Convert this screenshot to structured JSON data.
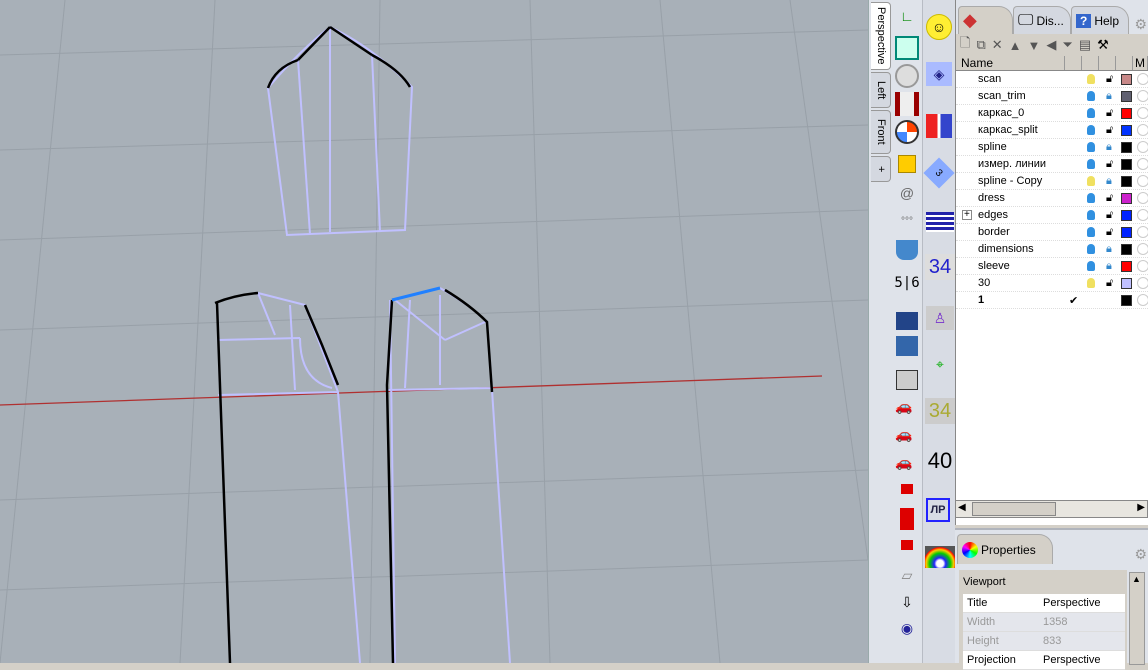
{
  "viewport_tabs": [
    {
      "label": "Perspective",
      "active": true
    },
    {
      "label": "Left"
    },
    {
      "label": "Front"
    },
    {
      "label": "+"
    }
  ],
  "panel_tabs": [
    {
      "label": "",
      "icon": "layers-icon"
    },
    {
      "label": "Dis...",
      "icon": "display-icon"
    },
    {
      "label": "Help",
      "icon": "help-icon"
    }
  ],
  "layers": {
    "header": {
      "name": "Name",
      "m": "M"
    },
    "rows": [
      {
        "name": "scan",
        "bulb": "#f0e060",
        "locked": false,
        "color": "#c88888"
      },
      {
        "name": "scan_trim",
        "bulb": "#3090e0",
        "locked": true,
        "color": "#606070"
      },
      {
        "name": "каркас_0",
        "bulb": "#3090e0",
        "locked": false,
        "color": "#ff0000"
      },
      {
        "name": "каркас_split",
        "bulb": "#3090e0",
        "locked": false,
        "color": "#0033ff"
      },
      {
        "name": "spline",
        "bulb": "#3090e0",
        "locked": true,
        "color": "#000000"
      },
      {
        "name": "измер. линии",
        "bulb": "#3090e0",
        "locked": false,
        "color": "#000000"
      },
      {
        "name": "spline - Copy",
        "bulb": "#f0e060",
        "locked": true,
        "color": "#000000"
      },
      {
        "name": "dress",
        "bulb": "#3090e0",
        "locked": false,
        "color": "#cc22cc"
      },
      {
        "name": "edges",
        "bulb": "#3090e0",
        "locked": false,
        "color": "#0022ff",
        "expand": "+"
      },
      {
        "name": "border",
        "bulb": "#3090e0",
        "locked": false,
        "color": "#0022ff"
      },
      {
        "name": "dimensions",
        "bulb": "#3090e0",
        "locked": true,
        "color": "#000000"
      },
      {
        "name": "sleeve",
        "bulb": "#3090e0",
        "locked": true,
        "color": "#ff0000"
      },
      {
        "name": "30",
        "bulb": "#f0e060",
        "locked": false,
        "color": "#c0c0ff"
      },
      {
        "name": "1",
        "current": "✔",
        "color": "#000000"
      }
    ]
  },
  "properties": {
    "tab": "Properties",
    "section": "Viewport",
    "rows": [
      {
        "label": "Title",
        "value": "Perspective",
        "enabled": true
      },
      {
        "label": "Width",
        "value": "1358",
        "enabled": false
      },
      {
        "label": "Height",
        "value": "833",
        "enabled": false
      },
      {
        "label": "Projection",
        "value": "Perspective",
        "enabled": true
      }
    ]
  },
  "toolbar_text": {
    "t1": "34",
    "t2": "34",
    "t3": "40",
    "t4": "ЛР",
    "t5": "5|6"
  }
}
